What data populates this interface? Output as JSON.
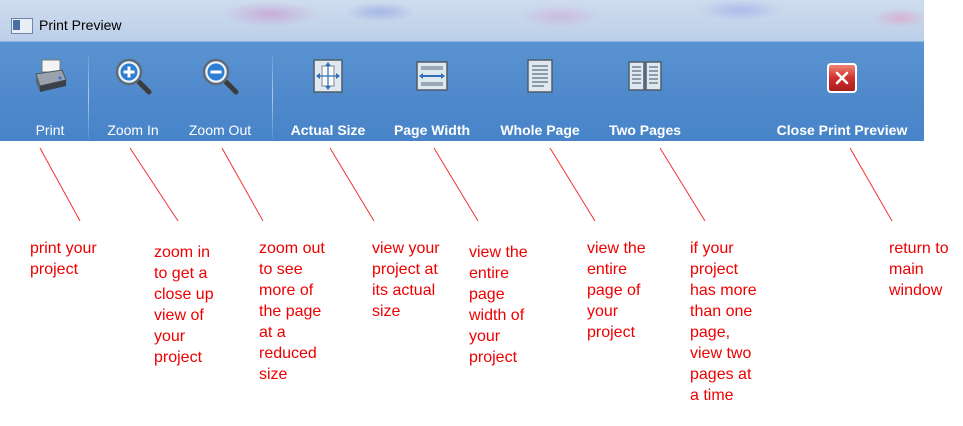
{
  "window": {
    "title": "Print Preview"
  },
  "toolbar": {
    "print": {
      "label": "Print",
      "icon": "printer-icon"
    },
    "zoom_in": {
      "label": "Zoom In",
      "icon": "zoom-in-icon"
    },
    "zoom_out": {
      "label": "Zoom Out",
      "icon": "zoom-out-icon"
    },
    "actual_size": {
      "label": "Actual Size",
      "icon": "actual-size-icon"
    },
    "page_width": {
      "label": "Page Width",
      "icon": "page-width-icon"
    },
    "whole_page": {
      "label": "Whole Page",
      "icon": "whole-page-icon"
    },
    "two_pages": {
      "label": "Two Pages",
      "icon": "two-pages-icon"
    },
    "close": {
      "label": "Close Print Preview",
      "icon": "close-icon"
    }
  },
  "annotations": {
    "print": [
      "print your",
      "project"
    ],
    "zoom_in": [
      "zoom in",
      "to get a",
      "close up",
      "view of",
      "your",
      "project"
    ],
    "zoom_out": [
      "zoom out",
      "to see",
      "more of",
      "the page",
      "at a",
      "reduced",
      "size"
    ],
    "actual_size": [
      "view your",
      "project at",
      "its actual",
      "size"
    ],
    "page_width": [
      "view the",
      "entire",
      "page",
      "width of",
      "your",
      "project"
    ],
    "whole_page": [
      "view the",
      "entire",
      "page of",
      "your",
      "project"
    ],
    "two_pages": [
      "if your",
      "project",
      "has more",
      "than one",
      "page,",
      "view two",
      "pages at",
      "a time"
    ],
    "close": [
      "return to",
      "main",
      "window"
    ]
  },
  "colors": {
    "ribbon": "#4f89cb",
    "annotation_text": "#ee0000",
    "leader_line": "#ee3333",
    "close_button": "#d0312d"
  }
}
